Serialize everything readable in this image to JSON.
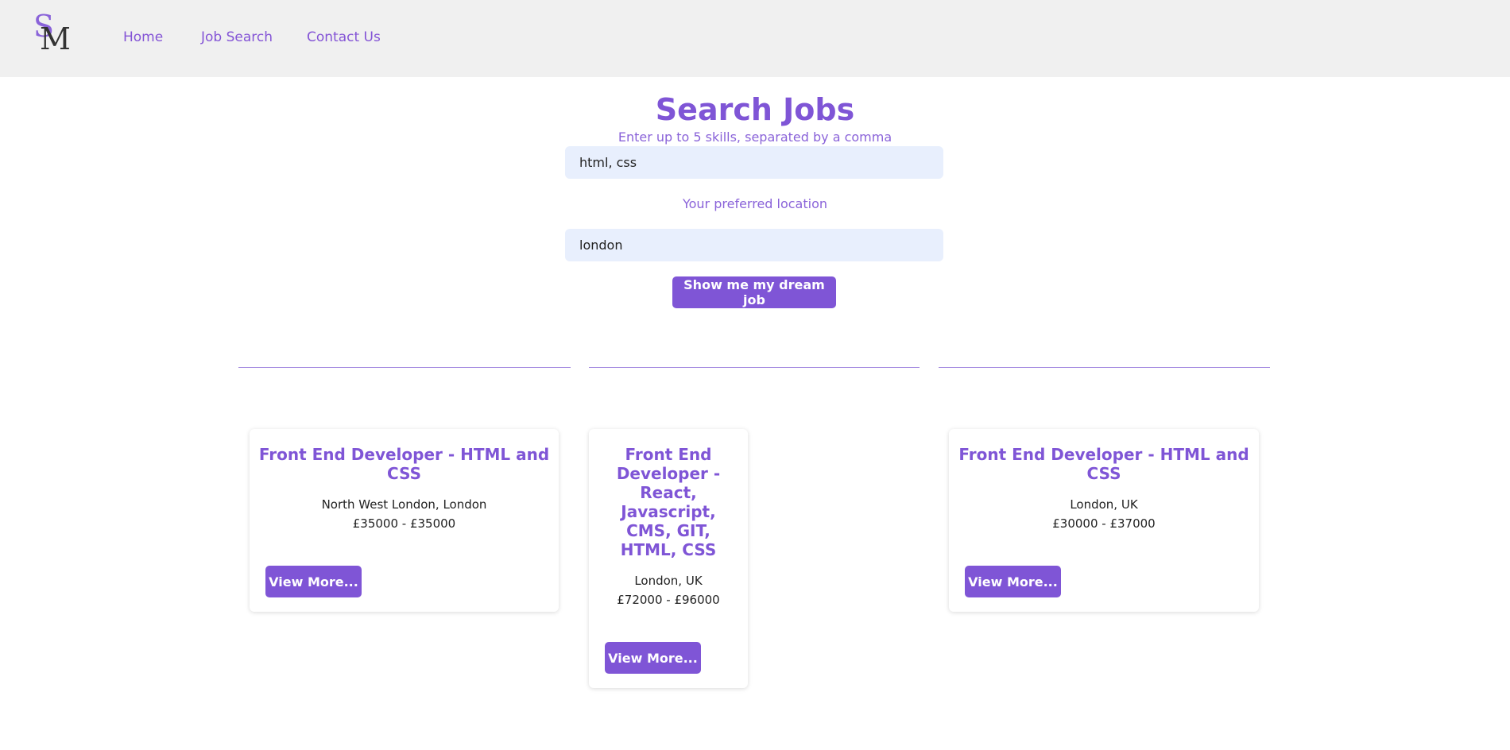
{
  "nav": {
    "logo": {
      "s": "S",
      "m": "M"
    },
    "links": [
      "Home",
      "Job Search",
      "Contact Us"
    ]
  },
  "search": {
    "title": "Search Jobs",
    "skills_hint": "Enter up to 5 skills, separated by a comma",
    "skills_value": "html, css",
    "location_hint": "Your preferred location",
    "location_value": "london",
    "submit_label": "Show me my dream job"
  },
  "jobs": [
    {
      "title": "Front End Developer - HTML and CSS",
      "location": "North West London, London",
      "salary": "£35000 - £35000",
      "button": "View More..."
    },
    {
      "title": "Front End Developer - React, Javascript, CMS, GIT, HTML, CSS",
      "location": "London, UK",
      "salary": "£72000 - £96000",
      "button": "View More..."
    },
    {
      "title": "Front End Developer - HTML and CSS",
      "location": "London, UK",
      "salary": "£30000 - £37000",
      "button": "View More..."
    }
  ],
  "colors": {
    "accent": "#7f55d6",
    "nav_bg": "#f0f0f0",
    "input_bg": "#e8effd"
  }
}
